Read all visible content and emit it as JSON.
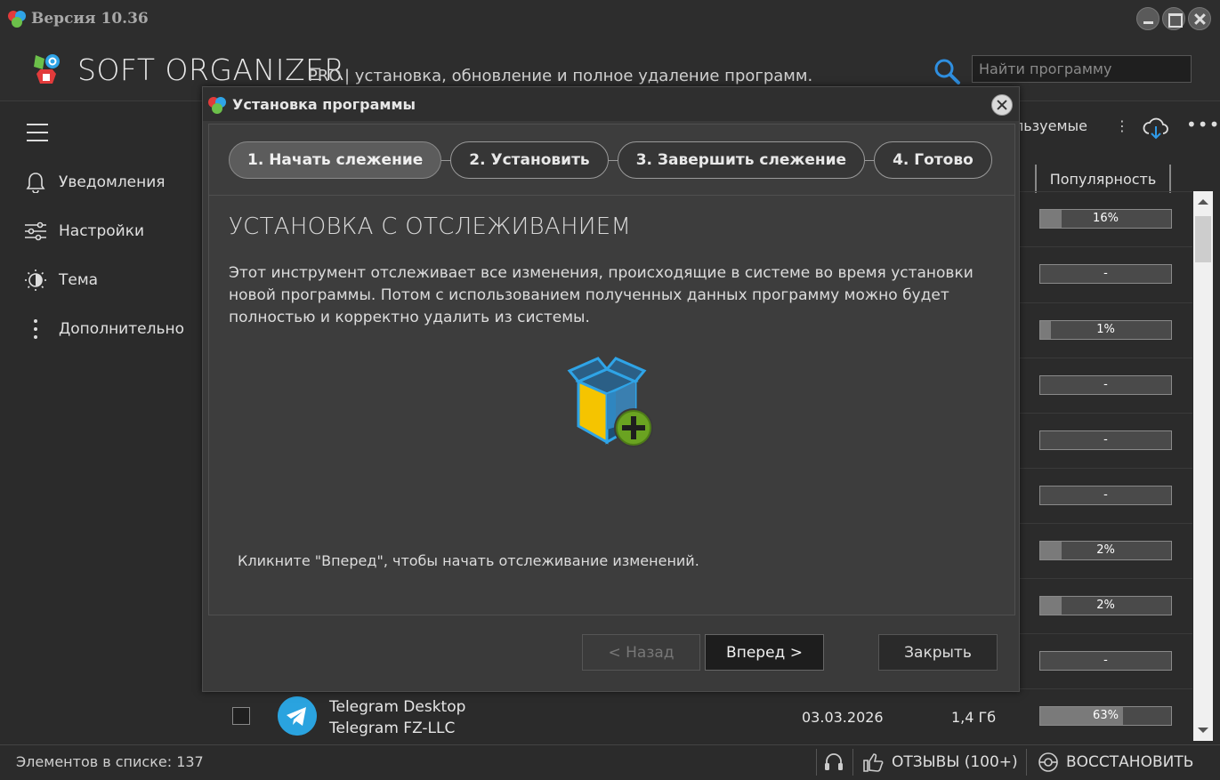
{
  "titlebar": {
    "version": "Версия 10.36"
  },
  "header": {
    "app_name": "SOFT ORGANIZER",
    "pro": "PRO",
    "tagline": "| установка, обновление и полное удаление программ.",
    "search_placeholder": "Найти программу"
  },
  "sidebar": {
    "items": [
      {
        "label": "Уведомления",
        "icon": "bell-icon"
      },
      {
        "label": "Настройки",
        "icon": "sliders-icon"
      },
      {
        "label": "Тема",
        "icon": "theme-icon"
      },
      {
        "label": "Дополнительно",
        "icon": "more-vertical-icon"
      }
    ]
  },
  "list": {
    "toolbar_partial_label": "льзуемые",
    "popularity_header": "Популярность",
    "popularity": [
      {
        "text": "16%",
        "value": 0.16
      },
      {
        "text": "-",
        "value": 0
      },
      {
        "text": "1%",
        "value": 0.01
      },
      {
        "text": "-",
        "value": 0
      },
      {
        "text": "-",
        "value": 0
      },
      {
        "text": "-",
        "value": 0
      },
      {
        "text": "2%",
        "value": 0.02
      },
      {
        "text": "2%",
        "value": 0.02
      },
      {
        "text": "-",
        "value": 0
      },
      {
        "text": "63%",
        "value": 0.63
      }
    ],
    "telegram": {
      "name": "Telegram Desktop",
      "publisher": "Telegram FZ-LLC",
      "date": "03.03.2026",
      "size": "1,4 Гб"
    }
  },
  "statusbar": {
    "count": "Элементов в списке: 137",
    "reviews": "ОТЗЫВЫ (100+)",
    "restore": "ВОССТАНОВИТЬ"
  },
  "modal": {
    "title": "Установка программы",
    "steps": [
      "1. Начать слежение",
      "2. Установить",
      "3. Завершить слежение",
      "4. Готово"
    ],
    "active_step": 0,
    "heading": "УСТАНОВКА С ОТСЛЕЖИВАНИЕМ",
    "description": "Этот инструмент отслеживает все изменения, происходящие в системе во время установки новой программы. Потом с использованием полученных данных программу можно будет полностью и корректно удалить из системы.",
    "hint": "Кликните \"Вперед\", чтобы начать отслеживание изменений.",
    "buttons": {
      "back": "< Назад",
      "next": "Вперед >",
      "close": "Закрыть"
    }
  }
}
